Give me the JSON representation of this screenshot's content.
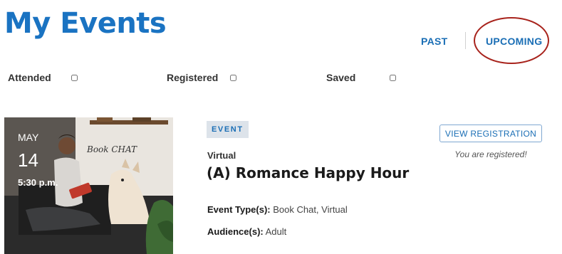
{
  "header": {
    "title": "My Events"
  },
  "tabs": {
    "past": "PAST",
    "upcoming": "UPCOMING"
  },
  "filters": [
    {
      "label": "Attended",
      "checked": false
    },
    {
      "label": "Registered",
      "checked": false
    },
    {
      "label": "Saved",
      "checked": false
    }
  ],
  "event": {
    "image_text": "Book CHAT",
    "month": "MAY",
    "day": "14",
    "time": "5:30 p.m.",
    "badge": "EVENT",
    "location": "Virtual",
    "title": "(A) Romance Happy Hour",
    "types_label": "Event Type(s):",
    "types_value": "Book Chat, Virtual",
    "audience_label": "Audience(s):",
    "audience_value": "Adult",
    "view_button": "VIEW REGISTRATION",
    "status": "You are registered!"
  },
  "colors": {
    "accent": "#1a73c2",
    "annotation": "#a8231c",
    "badge_bg": "#dde3ea"
  }
}
